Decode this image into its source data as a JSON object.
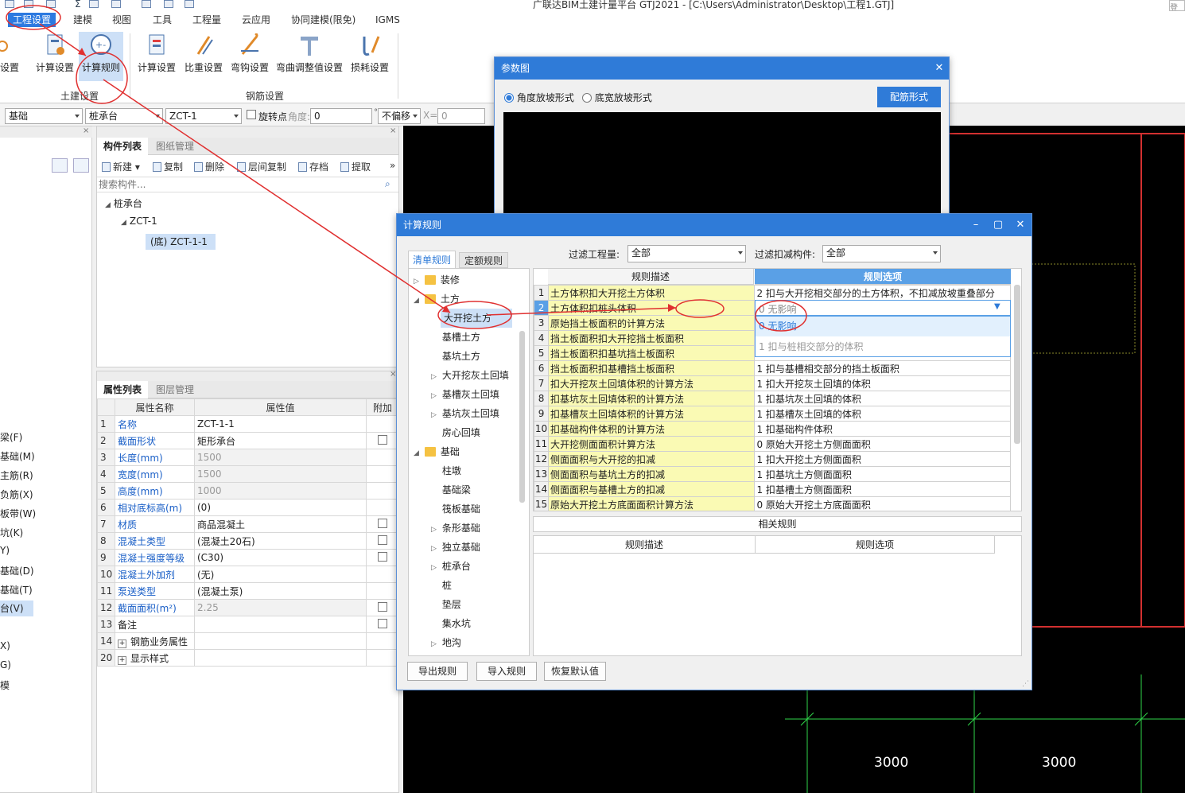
{
  "window": {
    "title": "广联达BIM土建计量平台 GTJ2021 - [C:\\Users\\Administrator\\Desktop\\工程1.GTJ]",
    "login_label": "登录"
  },
  "menu": [
    "工程设置",
    "建模",
    "视图",
    "工具",
    "工程量",
    "云应用",
    "协同建模(限免)",
    "IGMS"
  ],
  "ribbon": {
    "buttons": [
      "设置",
      "计算设置",
      "计算规则",
      "计算设置",
      "比重设置",
      "弯钩设置",
      "弯曲调整值设置",
      "损耗设置"
    ],
    "groups": [
      "土建设置",
      "钢筋设置"
    ]
  },
  "toolbar": {
    "floor_combo": "基础",
    "type_combo": "桩承台",
    "comp_combo": "ZCT-1",
    "rotate_label": "旋转点",
    "angle_label": "角度:",
    "angle_value": "0",
    "offset_combo": "不偏移",
    "x_label": "X=",
    "x_value": "0"
  },
  "left_partial": [
    "梁(F)",
    "基础(M)",
    "主筋(R)",
    "负筋(X)",
    "板带(W)",
    "坑(K)",
    "Y)",
    "基础(D)",
    "基础(T)",
    "台(V)",
    "X)",
    "G)",
    "模"
  ],
  "component_list": {
    "tabs": [
      "构件列表",
      "图纸管理"
    ],
    "actions": [
      "新建",
      "复制",
      "删除",
      "层间复制",
      "存档",
      "提取"
    ],
    "search_placeholder": "搜索构件...",
    "tree": [
      "桩承台",
      "ZCT-1",
      "(底) ZCT-1-1"
    ]
  },
  "property_list": {
    "tabs": [
      "属性列表",
      "图层管理"
    ],
    "headers": [
      "属性名称",
      "属性值",
      "附加"
    ],
    "rows": [
      {
        "n": "1",
        "name": "名称",
        "value": "ZCT-1-1"
      },
      {
        "n": "2",
        "name": "截面形状",
        "value": "矩形承台"
      },
      {
        "n": "3",
        "name": "长度(mm)",
        "value": "1500"
      },
      {
        "n": "4",
        "name": "宽度(mm)",
        "value": "1500"
      },
      {
        "n": "5",
        "name": "高度(mm)",
        "value": "1000"
      },
      {
        "n": "6",
        "name": "相对底标高(m)",
        "value": "(0)"
      },
      {
        "n": "7",
        "name": "材质",
        "value": "商品混凝土"
      },
      {
        "n": "8",
        "name": "混凝土类型",
        "value": "(混凝土20石)"
      },
      {
        "n": "9",
        "name": "混凝土强度等级",
        "value": "(C30)"
      },
      {
        "n": "10",
        "name": "混凝土外加剂",
        "value": "(无)"
      },
      {
        "n": "11",
        "name": "泵送类型",
        "value": "(混凝土泵)"
      },
      {
        "n": "12",
        "name": "截面面积(m²)",
        "value": "2.25"
      },
      {
        "n": "13",
        "name": "备注",
        "value": ""
      },
      {
        "n": "14",
        "name": "钢筋业务属性",
        "value": ""
      },
      {
        "n": "20",
        "name": "显示样式",
        "value": ""
      }
    ]
  },
  "param_dialog": {
    "title": "参数图",
    "radio1": "角度放坡形式",
    "radio2": "底宽放坡形式",
    "button": "配筋形式"
  },
  "calc_dialog": {
    "title": "计算规则",
    "tabs": [
      "清单规则",
      "定额规则"
    ],
    "filter_qty_label": "过滤工程量:",
    "filter_qty_value": "全部",
    "filter_deduct_label": "过滤扣减构件:",
    "filter_deduct_value": "全部",
    "tree": [
      "装修",
      "土方",
      "大开挖土方",
      "基槽土方",
      "基坑土方",
      "大开挖灰土回填",
      "基槽灰土回填",
      "基坑灰土回填",
      "房心回填",
      "基础",
      "柱墩",
      "基础梁",
      "筏板基础",
      "条形基础",
      "独立基础",
      "桩承台",
      "桩",
      "垫层",
      "集水坑",
      "地沟"
    ],
    "col_desc": "规则描述",
    "col_opt": "规则选项",
    "rules": [
      {
        "n": "1",
        "desc": "土方体积扣大开挖土方体积",
        "opt": "2  扣与大开挖相交部分的土方体积，不扣减放坡重叠部分"
      },
      {
        "n": "2",
        "desc": "土方体积扣桩头体积",
        "opt": "0  无影响"
      },
      {
        "n": "3",
        "desc": "原始挡土板面积的计算方法",
        "opt": ""
      },
      {
        "n": "4",
        "desc": "挡土板面积扣大开挖挡土板面积",
        "opt": ""
      },
      {
        "n": "5",
        "desc": "挡土板面积扣基坑挡土板面积",
        "opt": ""
      },
      {
        "n": "6",
        "desc": "挡土板面积扣基槽挡土板面积",
        "opt": "1  扣与基槽相交部分的挡土板面积"
      },
      {
        "n": "7",
        "desc": "扣大开挖灰土回填体积的计算方法",
        "opt": "1  扣大开挖灰土回填的体积"
      },
      {
        "n": "8",
        "desc": "扣基坑灰土回填体积的计算方法",
        "opt": "1  扣基坑灰土回填的体积"
      },
      {
        "n": "9",
        "desc": "扣基槽灰土回填体积的计算方法",
        "opt": "1  扣基槽灰土回填的体积"
      },
      {
        "n": "10",
        "desc": "扣基础构件体积的计算方法",
        "opt": "1  扣基础构件体积"
      },
      {
        "n": "11",
        "desc": "大开挖侧面面积计算方法",
        "opt": "0  原始大开挖土方侧面面积"
      },
      {
        "n": "12",
        "desc": "侧面面积与大开挖的扣减",
        "opt": "1  扣大开挖土方侧面面积"
      },
      {
        "n": "13",
        "desc": "侧面面积与基坑土方的扣减",
        "opt": "1  扣基坑土方侧面面积"
      },
      {
        "n": "14",
        "desc": "侧面面积与基槽土方的扣减",
        "opt": "1  扣基槽土方侧面面积"
      },
      {
        "n": "15",
        "desc": "原始大开挖土方底面面积计算方法",
        "opt": "0  原始大开挖土方底面面积"
      }
    ],
    "dropdown_options": [
      "0  无影响",
      "1  扣与桩相交部分的体积"
    ],
    "related_label": "相关规则",
    "related_cols": [
      "规则描述",
      "规则选项"
    ],
    "buttons": [
      "导出规则",
      "导入规则",
      "恢复默认值"
    ]
  },
  "cad": {
    "dim1": "3000",
    "dim2": "3000"
  },
  "colors": {
    "accent": "#2f7bd8",
    "annotation": "#e03030",
    "rule_desc_bg": "#fafab4",
    "grid_green": "#2fd64a"
  }
}
